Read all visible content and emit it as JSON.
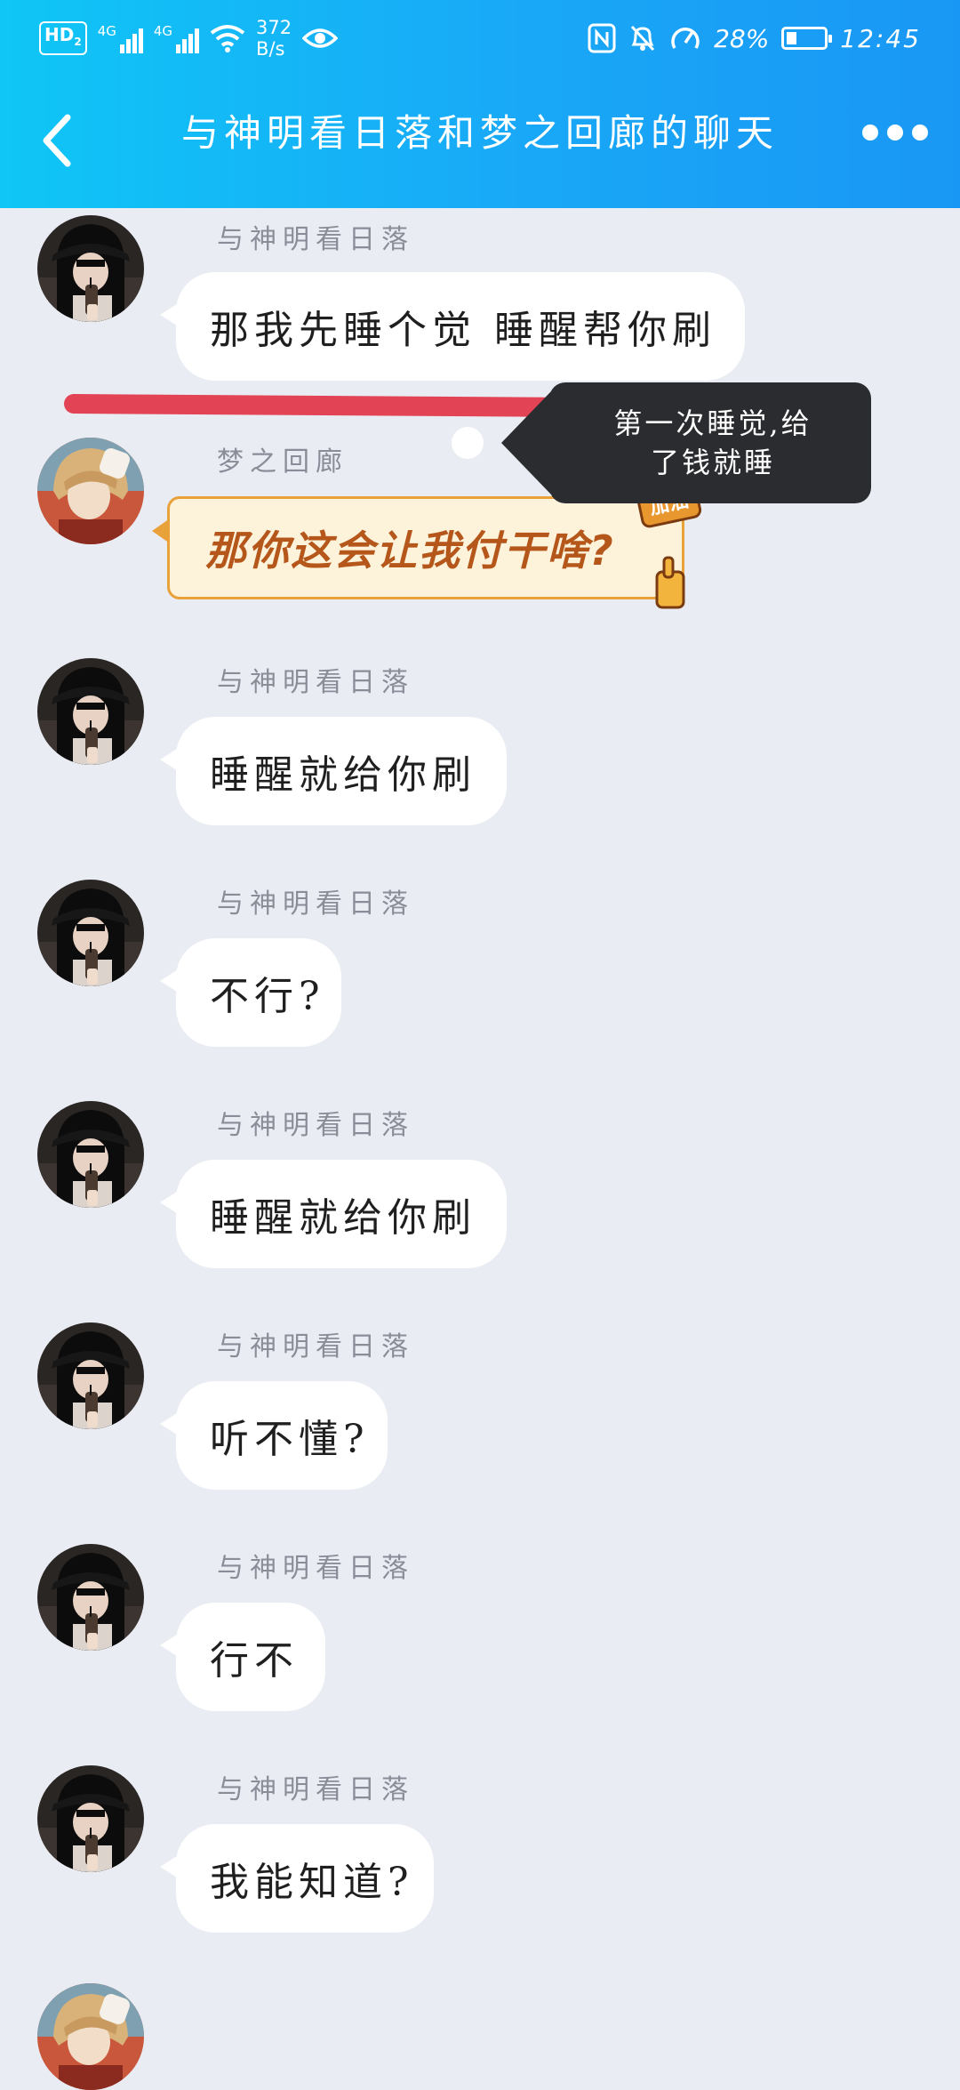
{
  "status_bar": {
    "hd_label": "HD",
    "hd_sub": "2",
    "network1": "4G",
    "network2": "4G",
    "speed_value": "372",
    "speed_unit": "B/s",
    "battery_percent": "28%",
    "battery_level": 0.28,
    "time": "12:45",
    "icons": [
      "nfc-icon",
      "mute-bell-icon",
      "performance-icon"
    ]
  },
  "header": {
    "title": "与神明看日落和梦之回廊的聊天",
    "back_icon": "chevron-left-icon",
    "more_icon": "more-dots-icon"
  },
  "messages": [
    {
      "sender": "与神明看日落",
      "text": "那我先睡个觉 睡醒帮你刷"
    },
    {
      "sender": "梦之回廊",
      "sticker_text": "那你这会让我付干啥?",
      "sticker_badge": "加油"
    },
    {
      "sender": "与神明看日落",
      "text": "睡醒就给你刷"
    },
    {
      "sender": "与神明看日落",
      "text": "不行?"
    },
    {
      "sender": "与神明看日落",
      "text": "睡醒就给你刷"
    },
    {
      "sender": "与神明看日落",
      "text": "听不懂?"
    },
    {
      "sender": "与神明看日落",
      "text": "行不"
    },
    {
      "sender": "与神明看日落",
      "text": "我能知道?"
    }
  ],
  "annotation": {
    "tooltip_line1": "第一次睡觉,给",
    "tooltip_line2": "了钱就睡",
    "strike_color": "#e23a4c"
  },
  "colors": {
    "header_gradient": [
      "#0fc6f6",
      "#1997f4"
    ],
    "background": "#eaecf3",
    "bubble": "#ffffff",
    "sender_name": "#8a8d98"
  }
}
